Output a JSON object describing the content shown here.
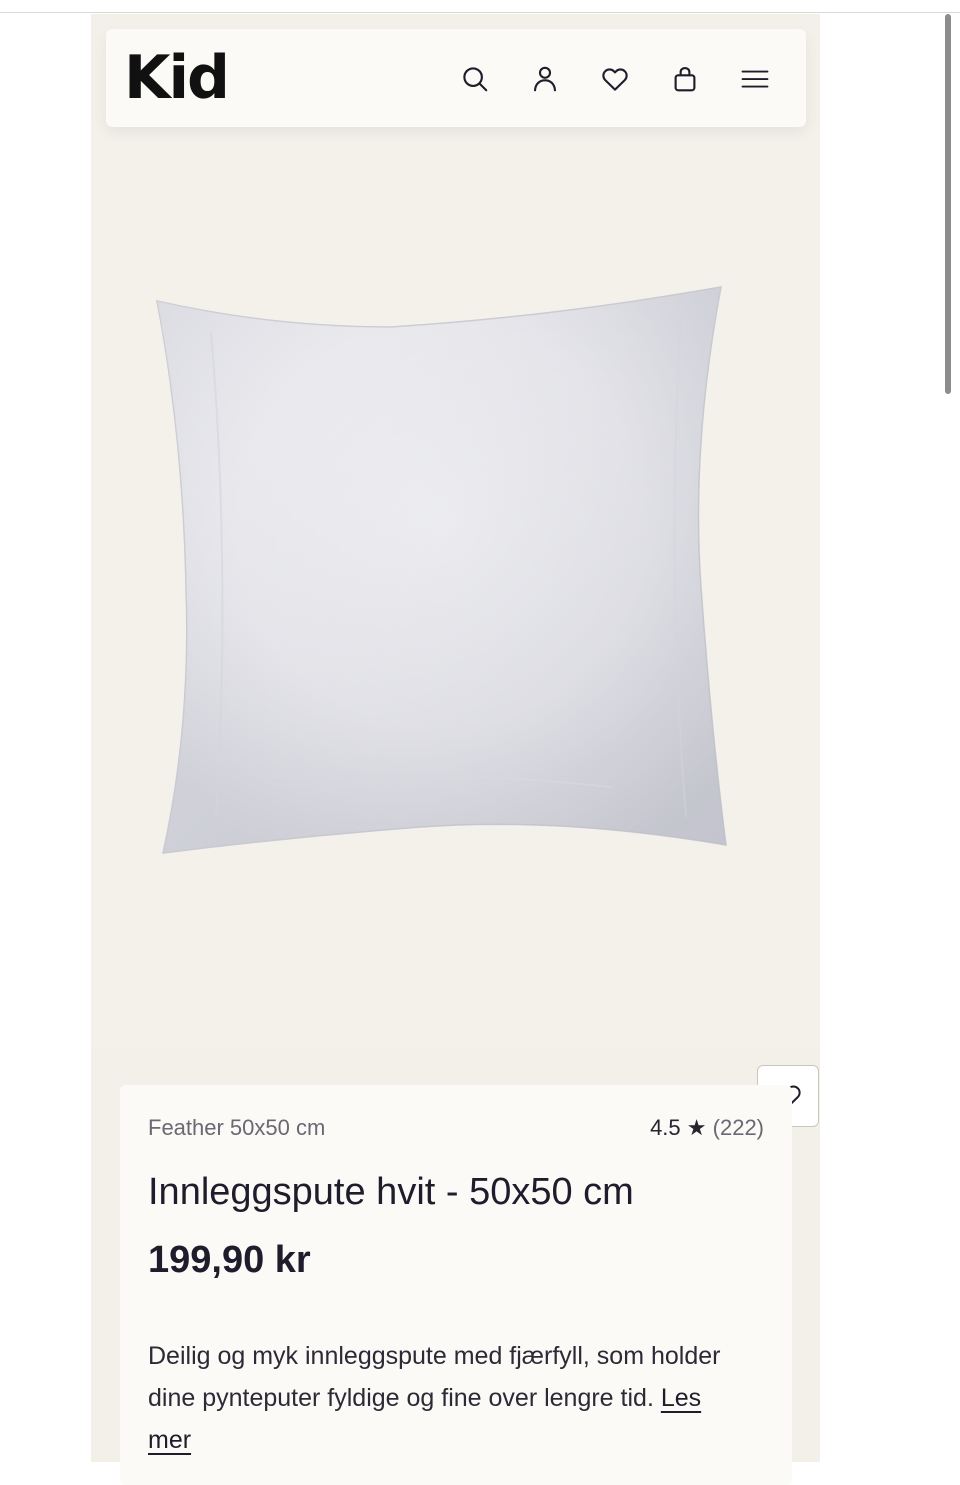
{
  "header": {
    "logo": "Kid",
    "icons": [
      "search-icon",
      "account-icon",
      "wishlist-icon",
      "cart-icon",
      "menu-icon"
    ]
  },
  "product": {
    "image_alt": "Innleggspute hvit",
    "variant": "Feather 50x50 cm",
    "rating": {
      "score": "4.5",
      "star": "★",
      "count": "(222)"
    },
    "title": "Innleggspute hvit - 50x50 cm",
    "price": "199,90 kr",
    "description": "Deilig og myk innleggspute med fjærfyll, som holder dine pynteputer fyldige og fine over lengre tid.",
    "read_more": "Les mer"
  },
  "colors": {
    "page_bg": "#f3f0ea",
    "card_bg": "#fbfaf6",
    "text": "#1f1d2b",
    "muted": "#6a6872"
  }
}
